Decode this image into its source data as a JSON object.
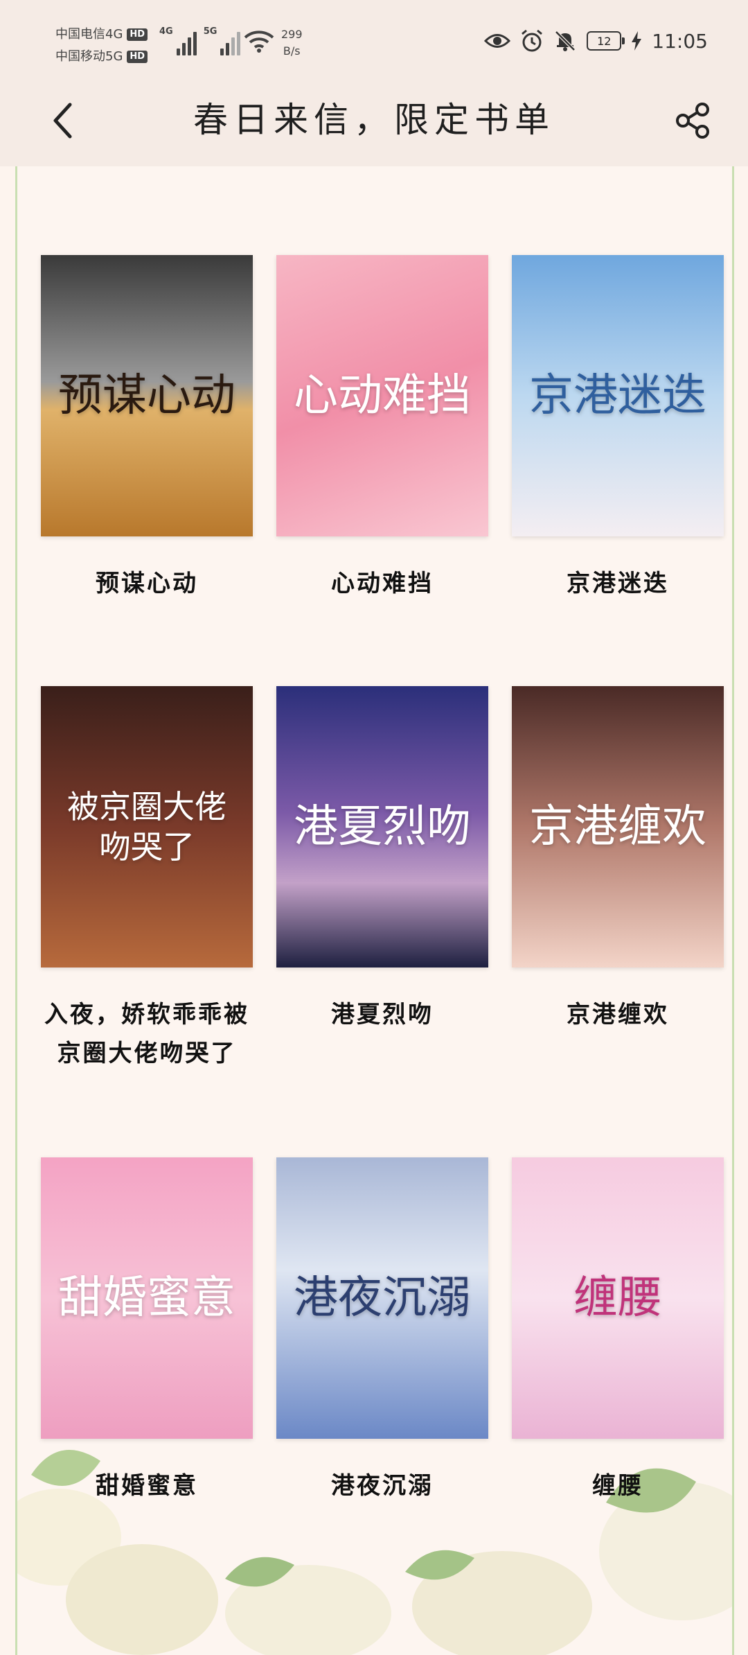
{
  "status_bar": {
    "carrier1": "中国电信4G",
    "carrier2": "中国移动5G",
    "hd": "HD",
    "net1": "4G",
    "net2": "5G",
    "speed_value": "299",
    "speed_unit": "B/s",
    "battery": "12",
    "time": "11:05"
  },
  "header": {
    "title": "春日来信，限定书单"
  },
  "books": [
    {
      "title": "预谋心动",
      "cover_text": "预谋心动",
      "bg": "linear-gradient(180deg,#3a3a3a 0%,#9a9a9a 45%,#e0b26a 55%,#b8782c 100%)",
      "fg": "#2a1a10"
    },
    {
      "title": "心动难挡",
      "cover_text": "心动难挡",
      "bg": "linear-gradient(160deg,#f7b6c4 0%,#f18fa8 50%,#f9c7d2 100%)",
      "fg": "#ffffff"
    },
    {
      "title": "京港迷迭",
      "cover_text": "京港迷迭",
      "bg": "linear-gradient(180deg,#6fa7de 0%,#bcd8f0 50%,#f4eef2 100%)",
      "fg": "#2f5f9e"
    },
    {
      "title": "入夜，娇软乖乖被京圈大佬吻哭了",
      "cover_text": "被京圈大佬吻哭了",
      "bg": "linear-gradient(180deg,#3a1f1a 0%,#7a3a2a 50%,#b76a3c 100%)",
      "fg": "#ffffff"
    },
    {
      "title": "港夏烈吻",
      "cover_text": "港夏烈吻",
      "bg": "linear-gradient(180deg,#2b2f7a 0%,#7c5aa8 45%,#c3a1c8 70%,#1e2040 100%)",
      "fg": "#ffffff"
    },
    {
      "title": "京港缠欢",
      "cover_text": "京港缠欢",
      "bg": "linear-gradient(180deg,#4a2a26 0%,#b0786a 50%,#f3d4c8 100%)",
      "fg": "#ffffff"
    },
    {
      "title": "甜婚蜜意",
      "cover_text": "甜婚蜜意",
      "bg": "linear-gradient(180deg,#f4a3c4 0%,#f7c2d6 50%,#ee9ec0 100%)",
      "fg": "#ffffff"
    },
    {
      "title": "港夜沉溺",
      "cover_text": "港夜沉溺",
      "bg": "linear-gradient(180deg,#a9b7d6 0%,#dfe6f2 40%,#6b88c6 100%)",
      "fg": "#2c3f70"
    },
    {
      "title": "缠腰",
      "cover_text": "缠腰",
      "bg": "linear-gradient(180deg,#f6cbe0 0%,#f9e2ee 50%,#eab3d4 100%)",
      "fg": "#c0337a"
    }
  ],
  "colors": {
    "header_bg": "#f5ebe5",
    "page_bg": "#fdf5f0",
    "border": "#c9dfb2"
  }
}
